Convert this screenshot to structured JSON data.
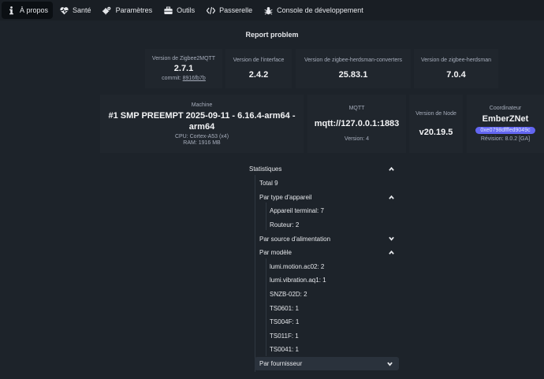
{
  "nav": {
    "items": [
      {
        "label": "À propos",
        "icon": "info-icon",
        "active": true
      },
      {
        "label": "Santé",
        "icon": "heart-pulse-icon"
      },
      {
        "label": "Paramètres",
        "icon": "cogs-icon"
      },
      {
        "label": "Outils",
        "icon": "toolbox-icon"
      },
      {
        "label": "Passerelle",
        "icon": "code-icon"
      },
      {
        "label": "Console de développement",
        "icon": "bug-icon"
      }
    ]
  },
  "report_label": "Report problem",
  "cards": {
    "z2m": {
      "label": "Version de Zigbee2MQTT",
      "value": "2.7.1",
      "commit_prefix": "commit:",
      "commit": "8916fb7b"
    },
    "frontend": {
      "label": "Version de l'interface",
      "value": "2.4.2"
    },
    "converters": {
      "label": "Version de zigbee-herdsman-converters",
      "value": "25.83.1"
    },
    "herdsman": {
      "label": "Version de zigbee-herdsman",
      "value": "7.0.4"
    },
    "machine": {
      "label": "Machine",
      "value_line1": "#1 SMP PREEMPT 2025-09-11 - 6.16.4-arm64 -",
      "value_line2": "arm64",
      "cpu": "CPU: Cortex-A53 (x4)",
      "ram": "RAM: 1916 MB"
    },
    "mqtt": {
      "label": "MQTT",
      "value": "mqtt://127.0.0.1:1883",
      "version": "Version: 4"
    },
    "node": {
      "label": "Version de Node",
      "value": "v20.19.5"
    },
    "coordinator": {
      "label": "Coordinateur",
      "value": "EmberZNet",
      "badge": "0xe0798dfffed9049c",
      "revision": "Révision: 8.0.2 [GA]"
    }
  },
  "stats": {
    "title": "Statistiques",
    "total": "Total 9",
    "by_type": {
      "label": "Par type d'appareil",
      "items": [
        "Appareil terminal: 7",
        "Routeur: 2"
      ]
    },
    "by_power": {
      "label": "Par source d'alimentation"
    },
    "by_model": {
      "label": "Par modèle",
      "items": [
        "lumi.motion.ac02: 2",
        "lumi.vibration.aq1: 1",
        "SNZB-02D: 2",
        "TS0601: 1",
        "TS004F: 1",
        "TS011F: 1",
        "TS0041: 1"
      ]
    },
    "by_vendor": {
      "label": "Par fournisseur"
    }
  }
}
